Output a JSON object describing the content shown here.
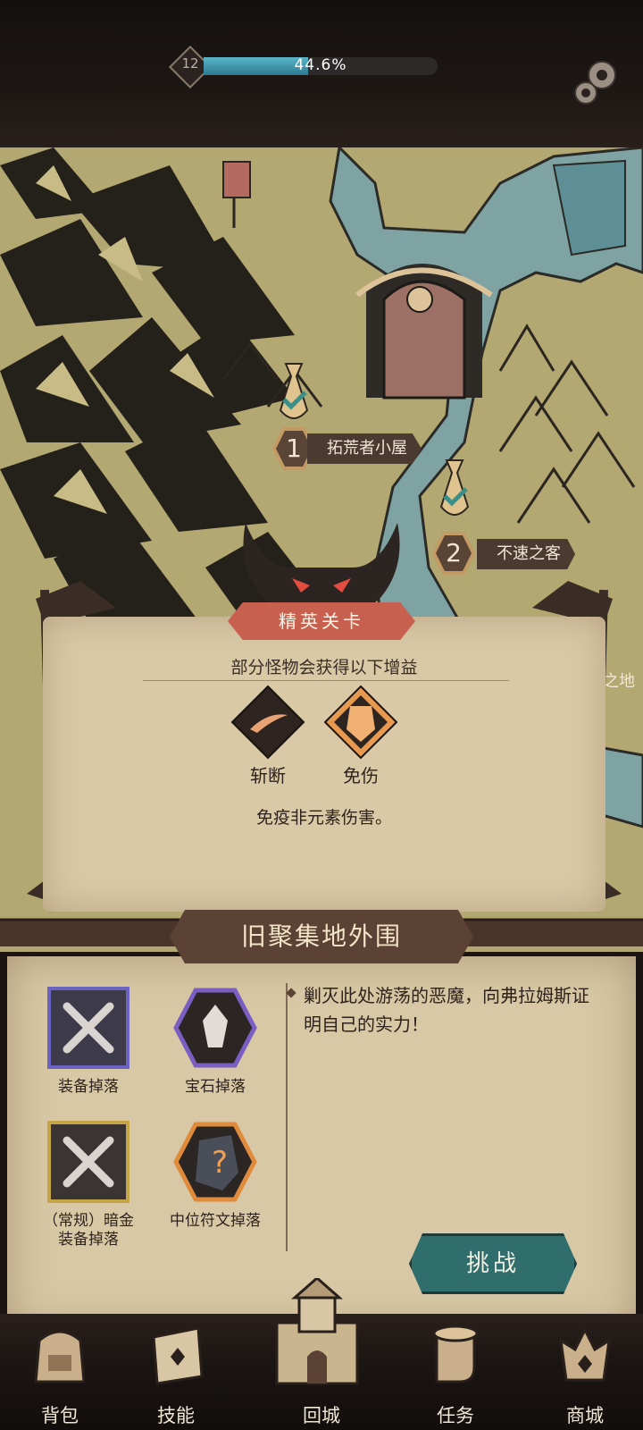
{
  "hud": {
    "level": "12",
    "progress_text": "44.6%",
    "progress_fraction": 0.446,
    "settings_icon": "gear-icon"
  },
  "map": {
    "nodes": [
      {
        "number": "1",
        "label": "拓荒者小屋",
        "status": "cleared"
      },
      {
        "number": "2",
        "label": "不速之客",
        "status": "cleared"
      }
    ],
    "edge_text": "之地"
  },
  "elite": {
    "title": "精英关卡",
    "subtitle": "部分怪物会获得以下增益",
    "buffs": [
      {
        "name": "斩断",
        "icon": "slash-icon"
      },
      {
        "name": "免伤",
        "icon": "shield-icon",
        "selected": true
      }
    ],
    "description": "免疫非元素伤害。"
  },
  "stage": {
    "title": "旧聚集地外围",
    "description": "剿灭此处游荡的恶魔，向弗拉姆斯证明自己的实力！",
    "rewards": [
      {
        "label": "装备掉落",
        "icon": "crossed-swords-icon"
      },
      {
        "label": "宝石掉落",
        "icon": "gem-icon"
      },
      {
        "label_line1": "（常规）暗金",
        "label_line2": "装备掉落",
        "icon": "crossed-swords-icon"
      },
      {
        "label": "中位符文掉落",
        "icon": "rune-icon"
      }
    ],
    "challenge_label": "挑战"
  },
  "nav": {
    "items": [
      {
        "label": "背包",
        "icon": "backpack-icon"
      },
      {
        "label": "技能",
        "icon": "skill-icon"
      },
      {
        "label": "回城",
        "icon": "castle-icon"
      },
      {
        "label": "任务",
        "icon": "scroll-icon"
      },
      {
        "label": "商城",
        "icon": "shop-icon"
      }
    ]
  },
  "colors": {
    "xp_fill": "#3a98ae",
    "elite_banner": "#c8604f",
    "challenge_button": "#2f6e6c",
    "parchment": "#d8c8a5"
  }
}
